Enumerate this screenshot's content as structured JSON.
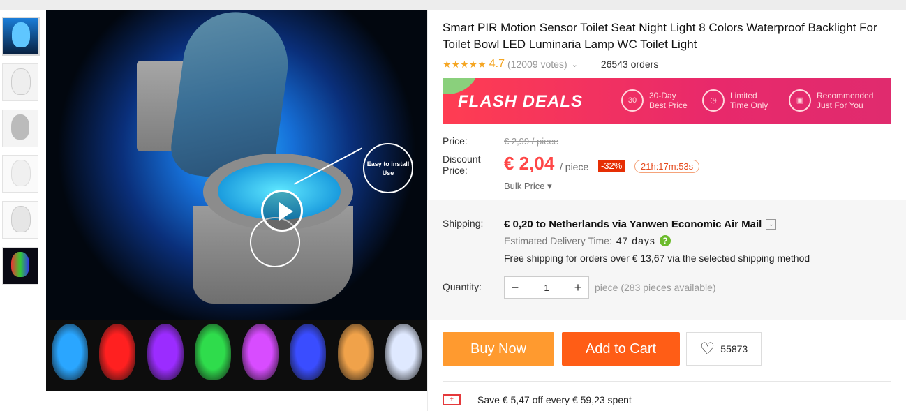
{
  "product": {
    "title": "Smart PIR Motion Sensor Toilet Seat Night Light 8 Colors Waterproof Backlight For Toilet Bowl LED Luminaria Lamp WC Toilet Light",
    "stars": "★★★★★",
    "rating": "4.7",
    "votes": "(12009 votes)",
    "orders": "26543 orders"
  },
  "gallery": {
    "install_label_line1": "Easy to install",
    "install_label_line2": "Use",
    "strip_colors": [
      "#2aa6ff",
      "#ff2020",
      "#9b2cff",
      "#2fdc4c",
      "#d84cff",
      "#3a4dff",
      "#f0a24a",
      "#dfe9ff"
    ]
  },
  "flash_deals": {
    "title": "FLASH DEALS",
    "features": [
      {
        "icon": "30",
        "line1": "30-Day",
        "line2": "Best Price"
      },
      {
        "icon": "clock-icon",
        "line1": "Limited",
        "line2": "Time Only"
      },
      {
        "icon": "gift-icon",
        "line1": "Recommended",
        "line2": "Just For You"
      }
    ]
  },
  "price": {
    "price_label": "Price:",
    "old_price": "€ 2,99 / piece",
    "discount_label_1": "Discount",
    "discount_label_2": "Price:",
    "new_price": "€ 2,04",
    "per_piece": "/ piece",
    "discount_pct": "-32%",
    "timer": "21h:17m:53s",
    "bulk_price": "Bulk Price ▾"
  },
  "shipping": {
    "label": "Shipping:",
    "method": "€ 0,20 to Netherlands via Yanwen Economic Air Mail",
    "edt_label": "Estimated Delivery Time:",
    "edt_days": "47 days",
    "free_shipping": "Free shipping for orders over € 13,67 via the selected shipping method"
  },
  "quantity": {
    "label": "Quantity:",
    "value": "1",
    "available": "piece (283 pieces available)"
  },
  "actions": {
    "buy_now": "Buy Now",
    "add_to_cart": "Add to Cart",
    "wishlist_count": "55873"
  },
  "coupon": {
    "text": "Save € 5,47 off every € 59,23 spent"
  },
  "colors": {
    "accent_orange": "#ff9a2f",
    "cart_orange": "#ff5d16",
    "price_red": "#ff4747",
    "star": "#f5a623"
  }
}
